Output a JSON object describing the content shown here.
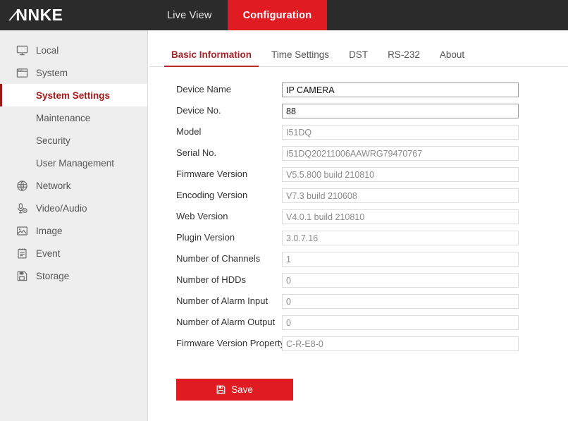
{
  "brand": {
    "name": "ANNKE"
  },
  "topnav": {
    "items": [
      {
        "label": "Live View",
        "active": false
      },
      {
        "label": "Configuration",
        "active": true
      }
    ]
  },
  "sidebar": {
    "items": [
      {
        "label": "Local",
        "icon": "monitor-icon",
        "type": "top",
        "active": false
      },
      {
        "label": "System",
        "icon": "window-icon",
        "type": "top",
        "active": false
      },
      {
        "label": "System Settings",
        "icon": "",
        "type": "sub",
        "active": true
      },
      {
        "label": "Maintenance",
        "icon": "",
        "type": "sub",
        "active": false
      },
      {
        "label": "Security",
        "icon": "",
        "type": "sub",
        "active": false
      },
      {
        "label": "User Management",
        "icon": "",
        "type": "sub",
        "active": false
      },
      {
        "label": "Network",
        "icon": "globe-icon",
        "type": "top",
        "active": false
      },
      {
        "label": "Video/Audio",
        "icon": "microphone-icon",
        "type": "top",
        "active": false
      },
      {
        "label": "Image",
        "icon": "picture-icon",
        "type": "top",
        "active": false
      },
      {
        "label": "Event",
        "icon": "clipboard-icon",
        "type": "top",
        "active": false
      },
      {
        "label": "Storage",
        "icon": "floppy-icon",
        "type": "top",
        "active": false
      }
    ]
  },
  "tabs": {
    "items": [
      {
        "label": "Basic Information",
        "active": true
      },
      {
        "label": "Time Settings",
        "active": false
      },
      {
        "label": "DST",
        "active": false
      },
      {
        "label": "RS-232",
        "active": false
      },
      {
        "label": "About",
        "active": false
      }
    ]
  },
  "form": {
    "fields": [
      {
        "label": "Device Name",
        "value": "IP CAMERA",
        "readonly": false
      },
      {
        "label": "Device No.",
        "value": "88",
        "readonly": false
      },
      {
        "label": "Model",
        "value": "I51DQ",
        "readonly": true
      },
      {
        "label": "Serial No.",
        "value": "I51DQ20211006AAWRG79470767",
        "readonly": true
      },
      {
        "label": "Firmware Version",
        "value": "V5.5.800 build 210810",
        "readonly": true
      },
      {
        "label": "Encoding Version",
        "value": "V7.3 build 210608",
        "readonly": true
      },
      {
        "label": "Web Version",
        "value": "V4.0.1 build 210810",
        "readonly": true
      },
      {
        "label": "Plugin Version",
        "value": "3.0.7.16",
        "readonly": true
      },
      {
        "label": "Number of Channels",
        "value": "1",
        "readonly": true
      },
      {
        "label": "Number of HDDs",
        "value": "0",
        "readonly": true
      },
      {
        "label": "Number of Alarm Input",
        "value": "0",
        "readonly": true
      },
      {
        "label": "Number of Alarm Output",
        "value": "0",
        "readonly": true
      },
      {
        "label": "Firmware Version Property",
        "value": "C-R-E8-0",
        "readonly": true
      }
    ]
  },
  "actions": {
    "save_label": "Save",
    "save_icon": "floppy-save-icon"
  },
  "colors": {
    "brand_red": "#e01b22",
    "accent_red": "#c0282f",
    "active_red": "#a31b1b",
    "topbar_dark": "#2b2b2b",
    "sidebar_bg": "#eeeeee"
  }
}
